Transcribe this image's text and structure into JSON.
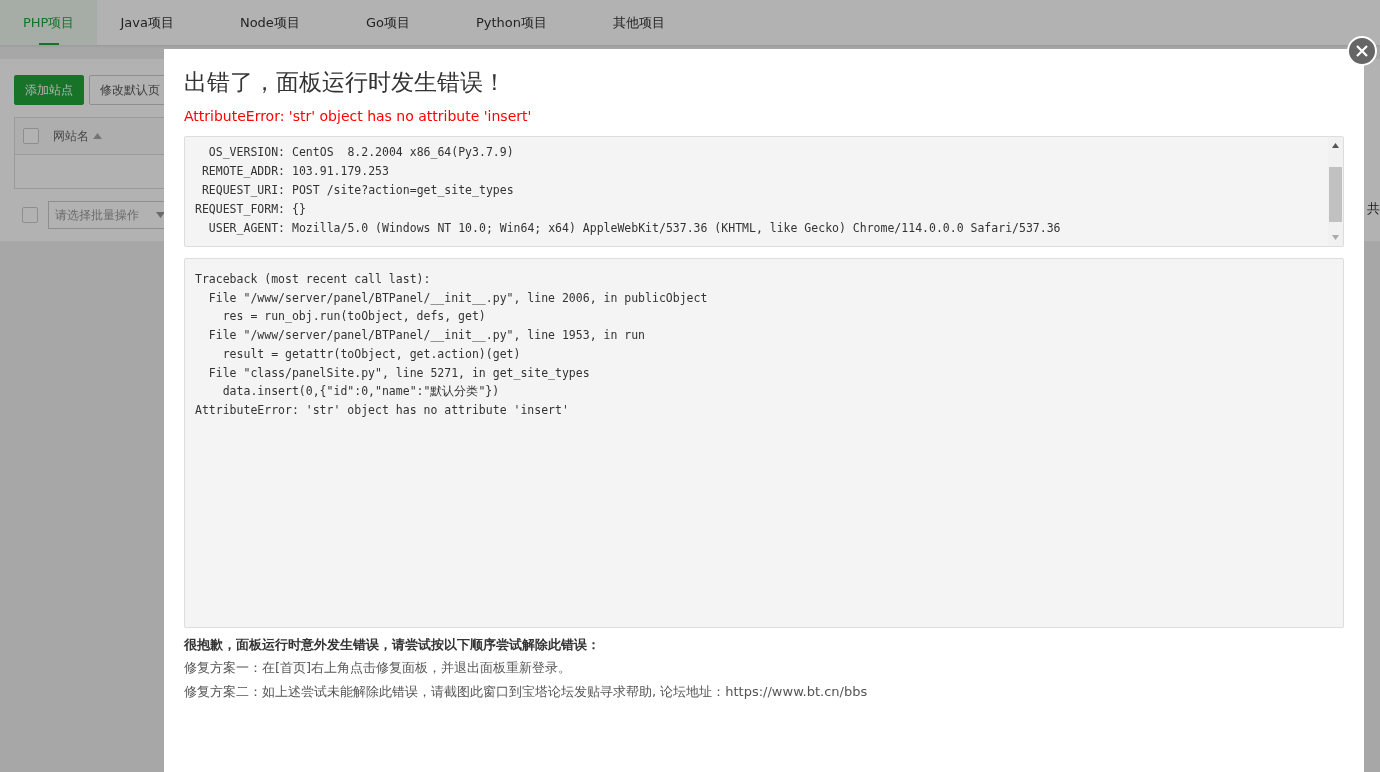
{
  "tabs": [
    {
      "label": "PHP项目",
      "selected": true
    },
    {
      "label": "Java项目",
      "selected": false
    },
    {
      "label": "Node项目",
      "selected": false
    },
    {
      "label": "Go项目",
      "selected": false
    },
    {
      "label": "Python项目",
      "selected": false
    },
    {
      "label": "其他项目",
      "selected": false
    }
  ],
  "toolbar": {
    "primary_button": "添加站点",
    "secondary_button": "修改默认页"
  },
  "table": {
    "select_all": {
      "checked": false
    },
    "columns": [
      {
        "label": "网站名",
        "sorted_ascending": true
      }
    ]
  },
  "footer": {
    "select_all": {
      "checked": false
    },
    "batch_select": {
      "placeholder": "请选择批量操作"
    },
    "total_text": "共"
  },
  "dialog": {
    "title": "出错了，面板运行时发生错误！",
    "error": "AttributeError: 'str' object has no attribute 'insert'",
    "info": [
      {
        "key": "OS_VERSION:",
        "value": "CentOS  8.2.2004 x86_64(Py3.7.9)"
      },
      {
        "key": "REMOTE_ADDR:",
        "value": "103.91.179.253"
      },
      {
        "key": "REQUEST_URI:",
        "value": "POST /site?action=get_site_types"
      },
      {
        "key": "REQUEST_FORM:",
        "value": "{}"
      },
      {
        "key": "USER_AGENT:",
        "value": "Mozilla/5.0 (Windows NT 10.0; Win64; x64) AppleWebKit/537.36 (KHTML, like Gecko) Chrome/114.0.0.0 Safari/537.36"
      }
    ],
    "traceback": [
      "Traceback (most recent call last):",
      "  File \"/www/server/panel/BTPanel/__init__.py\", line 2006, in publicObject",
      "    res = run_obj.run(toObject, defs, get)",
      "  File \"/www/server/panel/BTPanel/__init__.py\", line 1953, in run",
      "    result = getattr(toObject, get.action)(get)",
      "  File \"class/panelSite.py\", line 5271, in get_site_types",
      "    data.insert(0,{\"id\":0,\"name\":\"默认分类\"})",
      "AttributeError: 'str' object has no attribute 'insert'"
    ],
    "help_title": "很抱歉，面板运行时意外发生错误，请尝试按以下顺序尝试解除此错误：",
    "help_lines": [
      "修复方案一：在[首页]右上角点击修复面板，并退出面板重新登录。",
      "修复方案二：如上述尝试未能解除此错误，请截图此窗口到宝塔论坛发贴寻求帮助, 论坛地址：https://www.bt.cn/bbs"
    ]
  }
}
